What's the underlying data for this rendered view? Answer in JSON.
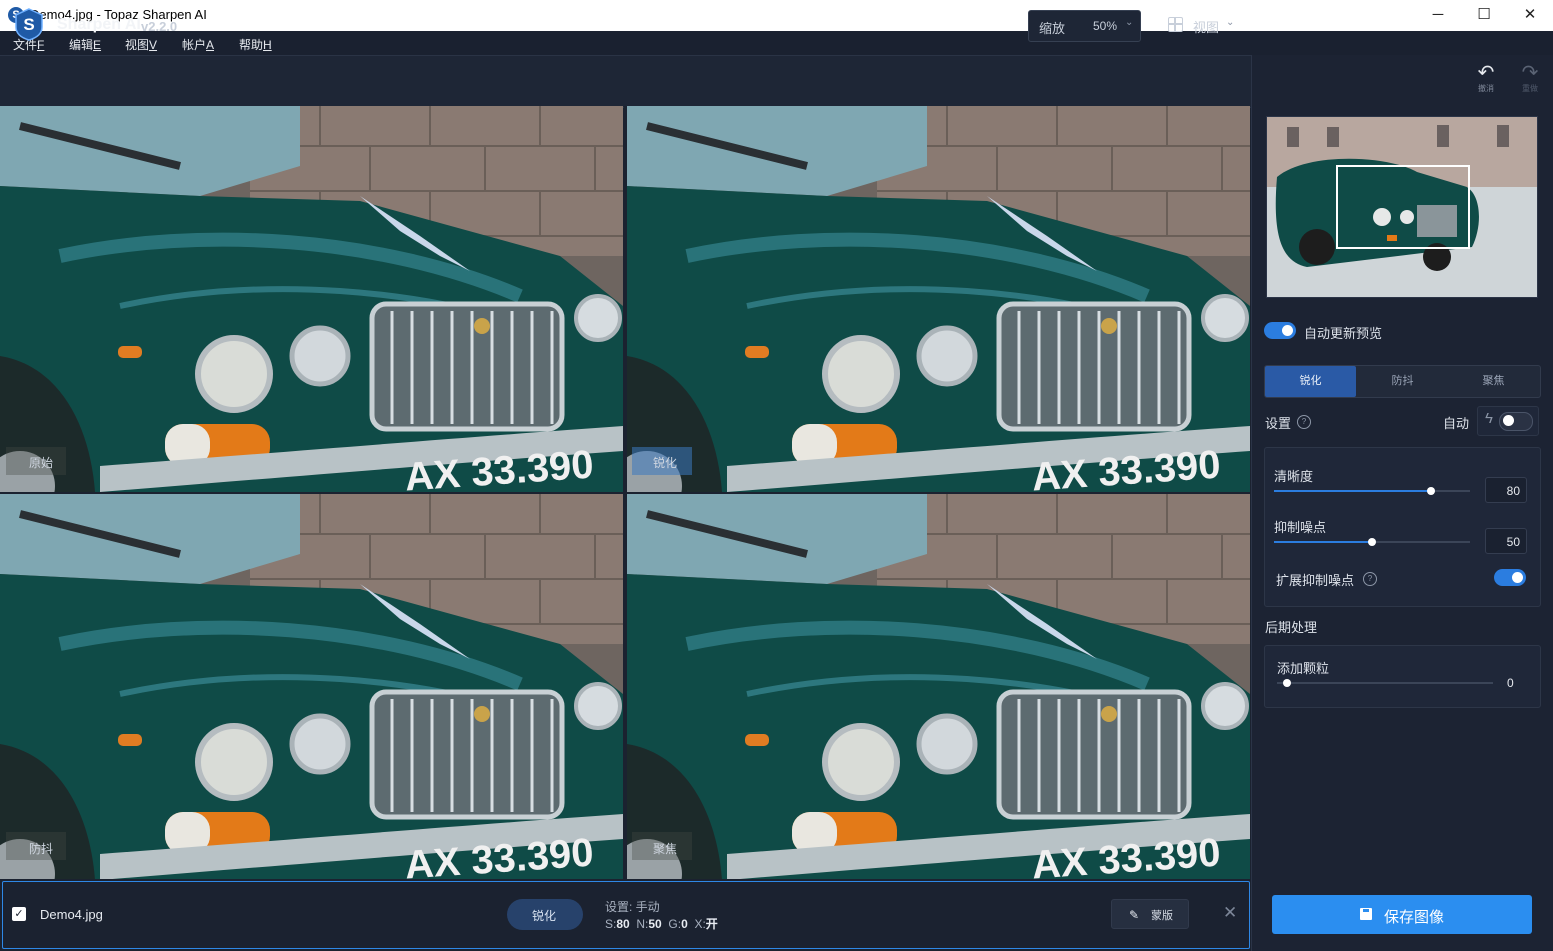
{
  "window": {
    "title": "Demo4.jpg - Topaz Sharpen AI",
    "minimize": "─",
    "maximize": "☐",
    "close": "✕"
  },
  "menu": [
    {
      "label": "文件",
      "key": "F"
    },
    {
      "label": "编辑",
      "key": "E"
    },
    {
      "label": "视图",
      "key": "V"
    },
    {
      "label": "帐户",
      "key": "A"
    },
    {
      "label": "帮助",
      "key": "H"
    }
  ],
  "header": {
    "app_name": "Sharpen AI",
    "version": "v2.2.0",
    "zoom_label": "缩放",
    "zoom_value": "50%",
    "view_label": "视图",
    "chevron": "⌄"
  },
  "history": {
    "undo_label": "撤消",
    "redo_label": "重做",
    "undo_glyph": "↶",
    "redo_glyph": "↷"
  },
  "panes": [
    {
      "label": "原始",
      "plate": "AX 33.390"
    },
    {
      "label": "锐化",
      "plate": "AX 33.390"
    },
    {
      "label": "防抖",
      "plate": "AX 33.390"
    },
    {
      "label": "聚焦",
      "plate": "AX 33.390"
    }
  ],
  "sidebar": {
    "auto_update_label": "自动更新预览",
    "auto_update_on": true,
    "tabs": [
      "锐化",
      "防抖",
      "聚焦"
    ],
    "active_tab": "锐化",
    "settings_label": "设置",
    "help_glyph": "?",
    "auto_label": "自动",
    "auto_on": false,
    "clarity": {
      "label": "清晰度",
      "value": "80",
      "level": 0.8
    },
    "noise": {
      "label": "抑制噪点",
      "value": "50",
      "level": 0.5
    },
    "extended_noise": {
      "label": "扩展抑制噪点",
      "on": true
    },
    "post_label": "后期处理",
    "grain": {
      "label": "添加颗粒",
      "value": "0",
      "level": 0.0
    },
    "save_label": "保存图像"
  },
  "bottom": {
    "checkbox_glyph": "✓",
    "file_name": "Demo4.jpg",
    "mode": "锐化",
    "settings_line1": "设置: 手动",
    "s_label": "S:",
    "s_value": "80",
    "n_label": "N:",
    "n_value": "50",
    "g_label": "G:",
    "g_value": "0",
    "x_label": "X:",
    "x_value": "开",
    "mask_label": "蒙版",
    "mask_glyph": "✎",
    "close_glyph": "✕"
  },
  "colors": {
    "accent": "#2b8ef0",
    "panel": "#1c2333",
    "car_green": "#0e4a45"
  }
}
